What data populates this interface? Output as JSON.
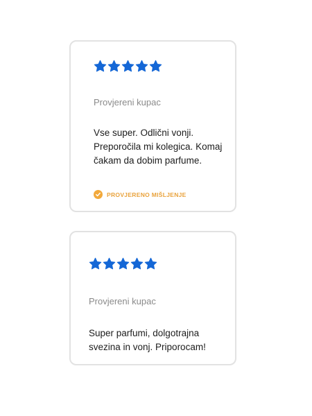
{
  "colors": {
    "star": "#1467d6",
    "verified": "#f2a93b",
    "border": "#e2e2e2"
  },
  "reviews": [
    {
      "rating": 5,
      "reviewer": "Provjereni kupac",
      "text": "Vse super. Odlični vonji. Preporočila mi kolegica. Komaj čakam da dobim parfume.",
      "verified_label": "PROVJERENO MIŠLJENJE",
      "verified_icon": "check-circle-icon"
    },
    {
      "rating": 5,
      "reviewer": "Provjereni kupac",
      "text": "Super parfumi, dolgotrajna svezina in vonj. Priporocam!"
    }
  ]
}
